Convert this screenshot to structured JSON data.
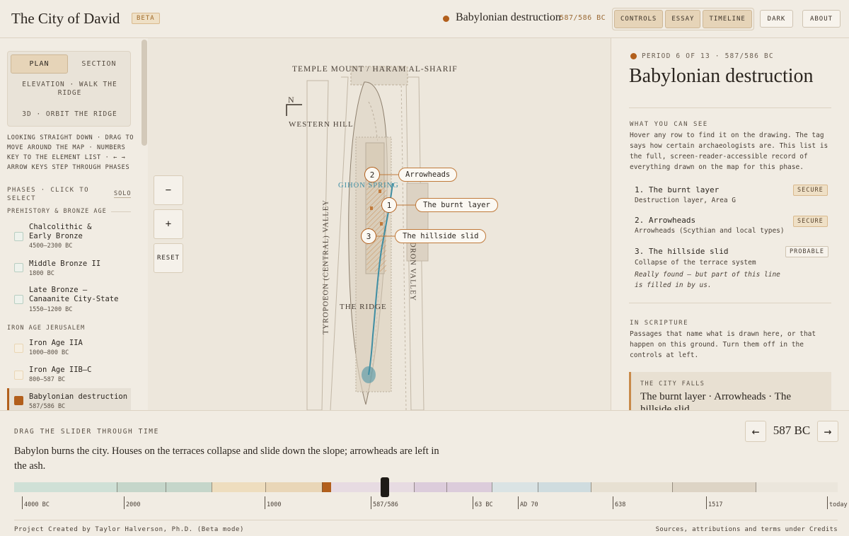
{
  "header": {
    "title": "The City of David",
    "badge": "BETA",
    "current_period": "Babylonian destruction",
    "current_date": "587/586 BC",
    "buttons": [
      "CONTROLS",
      "ESSAY",
      "TIMELINE"
    ],
    "dark_label": "DARK",
    "about_label": "ABOUT"
  },
  "views": {
    "plan": "PLAN",
    "section": "SECTION",
    "elevation": "ELEVATION · WALK THE RIDGE",
    "orbit": "3D · ORBIT THE RIDGE"
  },
  "help_text": "Looking straight down · drag to move around the map · numbers key to the element list · ← → arrow keys step through phases",
  "phases": {
    "header": "PHASES · CLICK TO SELECT",
    "solo_label": "SOLO",
    "groups": [
      {
        "label": "PREHISTORY & BRONZE AGE"
      },
      {
        "label": "IRON AGE JERUSALEM"
      }
    ],
    "items": [
      {
        "name": "Chalcolithic & Early Bronze",
        "date": "4500–2300 BC"
      },
      {
        "name": "Middle Bronze II",
        "date": "1800 BC"
      },
      {
        "name": "Late Bronze — Canaanite City-State",
        "date": "1550–1200 BC"
      },
      {
        "name": "Iron Age IIA",
        "date": "1000–800 BC"
      },
      {
        "name": "Iron Age IIB–C",
        "date": "800–587 BC"
      },
      {
        "name": "Babylonian destruction",
        "date": "587/586 BC"
      }
    ]
  },
  "map": {
    "labels": {
      "temple_mount": "TEMPLE MOUNT / HARAM AL-SHARIF",
      "western_hill": "WESTERN HILL",
      "north": "N",
      "gihon": "GIHON SPRING",
      "tyropoeon": "TYROPOEON (CENTRAL) VALLEY",
      "kidron": "KIDRON VALLEY",
      "ridge": "THE RIDGE"
    },
    "callouts": [
      {
        "num": "1",
        "label": "The burnt layer"
      },
      {
        "num": "2",
        "label": "Arrowheads"
      },
      {
        "num": "3",
        "label": "The hillside slid"
      }
    ],
    "zoom_out": "−",
    "zoom_in": "+",
    "reset": "RESET"
  },
  "panel": {
    "period_line": "PERIOD 6 OF 13 · 587/586 BC",
    "title": "Babylonian destruction",
    "see_header": "WHAT YOU CAN SEE",
    "see_text": "Hover any row to find it on the drawing. The tag says how certain archaeologists are. This list is the full, screen-reader-accessible record of everything drawn on the map for this phase.",
    "items": [
      {
        "name": "1. The burnt layer",
        "sub": "Destruction layer, Area G",
        "badge": "SECURE"
      },
      {
        "name": "2. Arrowheads",
        "sub": "Arrowheads (Scythian and local types)",
        "badge": "SECURE"
      },
      {
        "name": "3. The hillside slid",
        "sub": "Collapse of the terrace system",
        "badge": "PROBABLE",
        "note": "Really found — but part of this line is filled in by us."
      }
    ],
    "scripture_header": "IN SCRIPTURE",
    "scripture_text": "Passages that name what is drawn here, or that happen on this ground. Turn them off in the controls at left.",
    "quote_header": "THE CITY FALLS",
    "quote_text": "The burnt layer · Arrowheads · The hillside slid"
  },
  "timeline": {
    "header": "DRAG THE SLIDER THROUGH TIME",
    "narrative": "Babylon burns the city. Houses on the terraces collapse and slide down the slope; arrowheads are left in the ash.",
    "prev": "←",
    "next": "→",
    "current_year": "587 BC",
    "ticks": [
      "4000 BC",
      "2000",
      "1000",
      "587/586",
      "63 BC",
      "AD 70",
      "638",
      "1517",
      "today"
    ]
  },
  "footer": {
    "left": "Project Created by Taylor Halverson, Ph.D. (Beta mode)",
    "right": "Sources, attributions and terms under Credits"
  },
  "colors": {
    "accent": "#b25f1c",
    "water": "#3f8ea3",
    "background": "#f1ece3"
  }
}
